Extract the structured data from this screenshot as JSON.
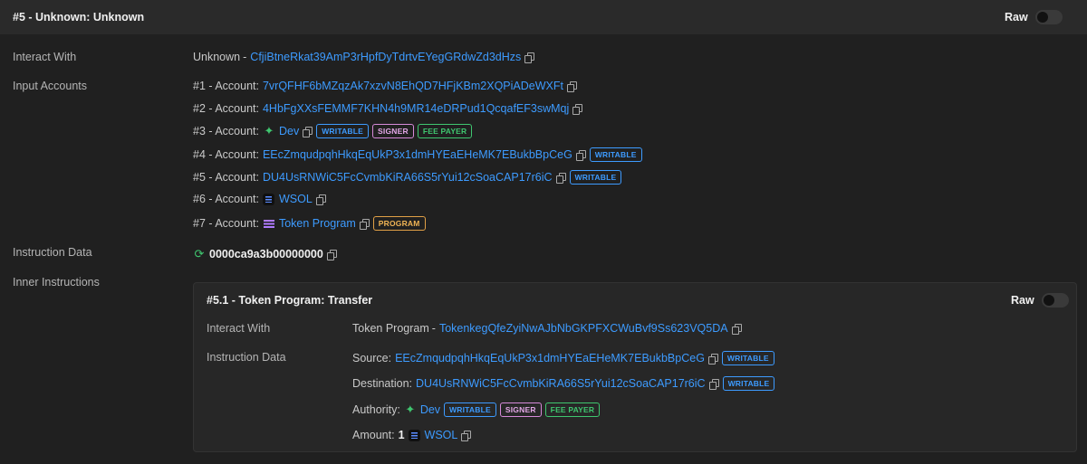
{
  "header": {
    "title": "#5 - Unknown: Unknown",
    "raw_label": "Raw"
  },
  "labels": {
    "interact_with": "Interact With",
    "input_accounts": "Input Accounts",
    "instruction_data": "Instruction Data",
    "inner_instructions": "Inner Instructions"
  },
  "interact": {
    "name": "Unknown",
    "dash": "-",
    "address": "CfjiBtneRkat39AmP3rHpfDyTdrtvEYegGRdwZd3dHzs"
  },
  "accounts": [
    {
      "prefix": "#1 - Account:",
      "value": "7vrQFHF6bMZqzAk7xzvN8EhQD7HFjKBm2XQPiADeWXFt",
      "icon": "",
      "badges": []
    },
    {
      "prefix": "#2 - Account:",
      "value": "4HbFgXXsFEMMF7KHN4h9MR14eDRPud1QcqafEF3swMqj",
      "icon": "",
      "badges": []
    },
    {
      "prefix": "#3 - Account:",
      "value": "Dev",
      "icon": "dev-sparkle-icon",
      "badges": [
        "WRITABLE",
        "SIGNER",
        "FEE PAYER"
      ]
    },
    {
      "prefix": "#4 - Account:",
      "value": "EEcZmqudpqhHkqEqUkP3x1dmHYEaEHeMK7EBukbBpCeG",
      "icon": "",
      "badges": [
        "WRITABLE"
      ]
    },
    {
      "prefix": "#5 - Account:",
      "value": "DU4UsRNWiC5FcCvmbKiRA66S5rYui12cSoaCAP17r6iC",
      "icon": "",
      "badges": [
        "WRITABLE"
      ]
    },
    {
      "prefix": "#6 - Account:",
      "value": "WSOL",
      "icon": "solana-icon",
      "badges": []
    },
    {
      "prefix": "#7 - Account:",
      "value": "Token Program",
      "icon": "token-program-icon",
      "badges": [
        "PROGRAM"
      ]
    }
  ],
  "instruction_data": {
    "value": "0000ca9a3b00000000",
    "icon": "refresh-icon"
  },
  "inner": {
    "title": "#5.1 - Token Program: Transfer",
    "raw_label": "Raw",
    "interact_label": "Interact With",
    "data_label": "Instruction Data",
    "interact_name": "Token Program",
    "interact_dash": "-",
    "interact_address": "TokenkegQfeZyiNwAJbNbGKPFXCWuBvf9Ss623VQ5DA",
    "source_label": "Source:",
    "source_value": "EEcZmqudpqhHkqEqUkP3x1dmHYEaEHeMK7EBukbBpCeG",
    "source_badge": "WRITABLE",
    "destination_label": "Destination:",
    "destination_value": "DU4UsRNWiC5FcCvmbKiRA66S5rYui12cSoaCAP17r6iC",
    "destination_badge": "WRITABLE",
    "authority_label": "Authority:",
    "authority_value": "Dev",
    "authority_badges": [
      "WRITABLE",
      "SIGNER",
      "FEE PAYER"
    ],
    "amount_label": "Amount:",
    "amount_value": "1",
    "amount_token": "WSOL"
  },
  "colors": {
    "link": "#3d9bff",
    "writable": "#3d9bff",
    "signer": "#d68ad9",
    "fee_payer": "#3fc66f",
    "program": "#e0a046",
    "background": "#202020",
    "header_bg": "#2a2a2a"
  }
}
